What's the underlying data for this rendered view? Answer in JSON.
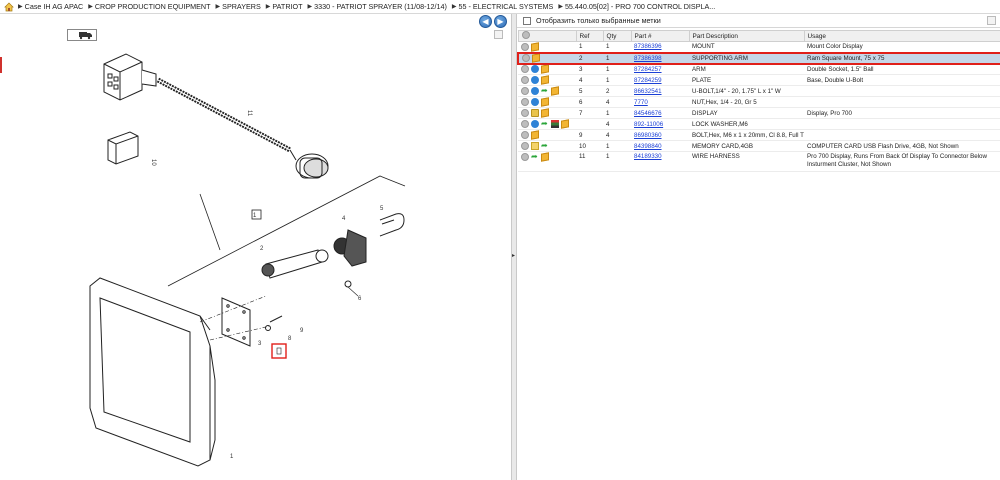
{
  "breadcrumb": {
    "items": [
      "Case IH AG APAC",
      "CROP PRODUCTION EQUIPMENT",
      "SPRAYERS",
      "PATRIOT",
      "3330 - PATRIOT SPRAYER (11/08-12/14)",
      "55 - ELECTRICAL SYSTEMS",
      "55.440.05[02] - PRO 700 CONTROL DISPLA..."
    ]
  },
  "filter": {
    "label": "Отобразить только выбранные метки"
  },
  "table": {
    "headers": [
      "Ref",
      "Qty",
      "Part #",
      "Part Description",
      "Usage"
    ],
    "rows": [
      {
        "ref": "1",
        "qty": "1",
        "part": "87386396",
        "desc": "MOUNT",
        "usage": "Mount Color Display"
      },
      {
        "ref": "2",
        "qty": "1",
        "part": "87386398",
        "desc": "SUPPORTING ARM",
        "usage": "Ram Square Mount, 75 x 75"
      },
      {
        "ref": "3",
        "qty": "1",
        "part": "87284257",
        "desc": "ARM",
        "usage": "Double Socket, 1.5\" Ball"
      },
      {
        "ref": "4",
        "qty": "1",
        "part": "87284259",
        "desc": "PLATE",
        "usage": "Base, Double U-Bolt"
      },
      {
        "ref": "5",
        "qty": "2",
        "part": "86632541",
        "desc": "U-BOLT,1/4\" - 20, 1.75\" L x 1\" W",
        "usage": ""
      },
      {
        "ref": "6",
        "qty": "4",
        "part": "7770",
        "desc": "NUT,Hex, 1/4 - 20, Gr 5",
        "usage": ""
      },
      {
        "ref": "7",
        "qty": "1",
        "part": "84546676",
        "desc": "DISPLAY",
        "usage": "Display, Pro 700"
      },
      {
        "ref": "",
        "qty": "4",
        "part": "892-11006",
        "desc": "LOCK WASHER,M6",
        "usage": ""
      },
      {
        "ref": "9",
        "qty": "4",
        "part": "86980360",
        "desc": "BOLT,Hex, M6 x 1 x 20mm, Cl 8.8, Full Thd",
        "usage": ""
      },
      {
        "ref": "10",
        "qty": "1",
        "part": "84398840",
        "desc": "MEMORY CARD,4GB",
        "usage": "COMPUTER CARD USB Flash Drive, 4GB, Not Shown"
      },
      {
        "ref": "11",
        "qty": "1",
        "part": "84189330",
        "desc": "WIRE HARNESS",
        "usage": "Pro 700 Display, Runs From Back Of Display To Connector Below Insturment Cluster, Not Shown"
      }
    ]
  },
  "drawing": {
    "callouts": [
      "1",
      "2",
      "3",
      "4",
      "5",
      "6",
      "8",
      "9",
      "10",
      "11"
    ]
  },
  "icons": {
    "home": "home-icon",
    "back": "arrow-left-icon",
    "forward": "arrow-right-icon"
  },
  "colors": {
    "selection_border": "#e0201a",
    "selection_fill": "#c6d7e8",
    "link": "#1a3fd6",
    "nav_button": "#2f6db8"
  }
}
